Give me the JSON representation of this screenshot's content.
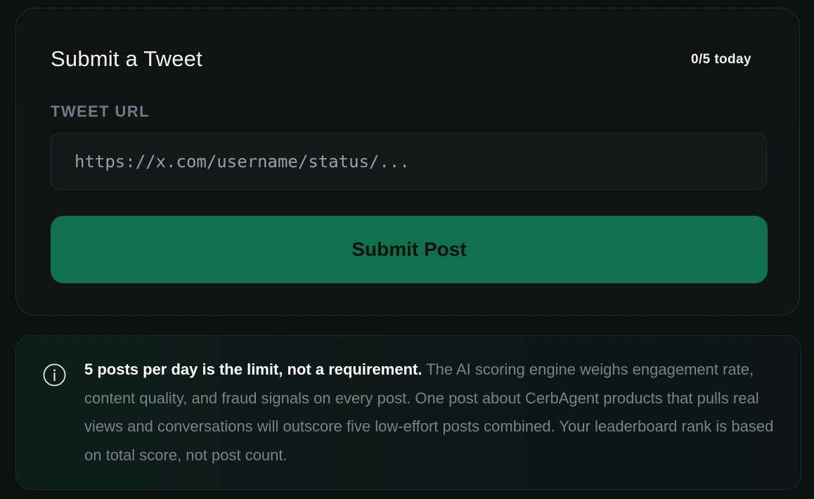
{
  "submit_card": {
    "title": "Submit a Tweet",
    "daily_count": "0/5 today",
    "field_label": "TWEET URL",
    "url_input": {
      "value": "",
      "placeholder": "https://x.com/username/status/..."
    },
    "submit_label": "Submit Post"
  },
  "notice": {
    "icon": "info-icon",
    "strong_text": "5 posts per day is the limit, not a requirement.",
    "body_text": "The AI scoring engine weighs engagement rate, content quality, and fraud signals on every post. One post about CerbAgent products that pulls real views and conversations will outscore five low-effort posts combined. Your leaderboard rank is based on total score, not post count."
  },
  "colors": {
    "accent": "#12704f",
    "background": "#0b1211",
    "card_border": "#17332b"
  }
}
